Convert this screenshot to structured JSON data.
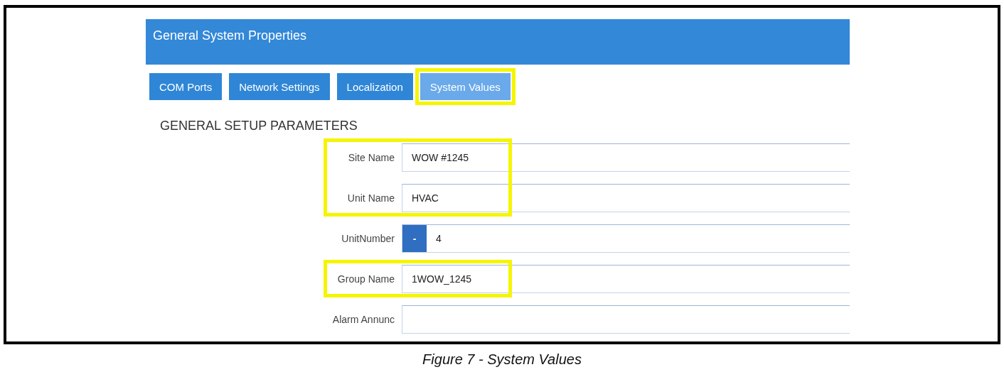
{
  "panel": {
    "title": "General System Properties"
  },
  "tabs": [
    {
      "label": "COM Ports",
      "selected": false,
      "highlighted": false
    },
    {
      "label": "Network Settings",
      "selected": false,
      "highlighted": false
    },
    {
      "label": "Localization",
      "selected": false,
      "highlighted": false
    },
    {
      "label": "System Values",
      "selected": true,
      "highlighted": true
    }
  ],
  "section_heading": "GENERAL SETUP PARAMETERS",
  "fields": [
    {
      "label": "Site Name",
      "kind": "text",
      "value": "WOW #1245",
      "highlighted": true
    },
    {
      "label": "Unit Name",
      "kind": "text",
      "value": "HVAC",
      "highlighted": true
    },
    {
      "label": "UnitNumber",
      "kind": "spinner",
      "button": "-",
      "value": "4",
      "highlighted": false
    },
    {
      "label": "Group Name",
      "kind": "text",
      "value": "1WOW_1245",
      "highlighted": true
    },
    {
      "label": "Alarm Annunc",
      "kind": "text",
      "highlighted": false
    }
  ],
  "caption": "Figure 7 - System Values"
}
